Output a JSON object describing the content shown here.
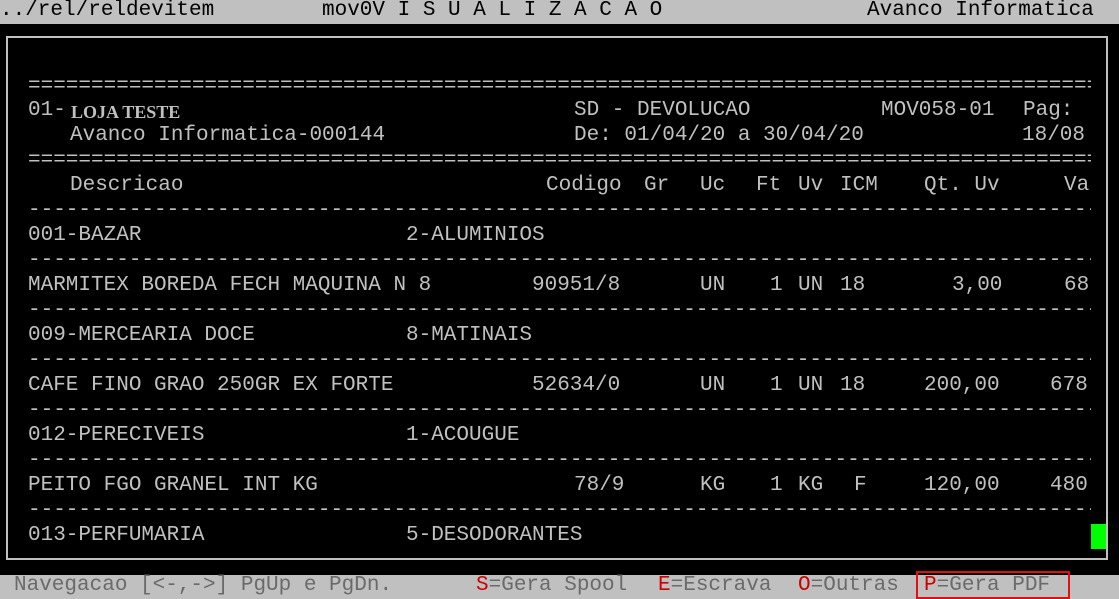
{
  "title_bar": {
    "path": "../rel/reldevitem",
    "screen_title": "mov0V I S U A L I Z A C A O",
    "company": "Avanco Informatica"
  },
  "report": {
    "separator_double": "==================================================================================================",
    "separator_single": "--------------------------------------------------------------------------------------------------",
    "header": {
      "store_code": "01-",
      "store_name": "LOJA TESTE",
      "doc_type": "SD - DEVOLUCAO",
      "report_code": "MOV058-01",
      "page_label": "Pag:",
      "company_line": "Avanco Informatica-000144",
      "period": "De: 01/04/20 a 30/04/20",
      "page_value": "18/08"
    },
    "columns": {
      "descricao": "Descricao",
      "codigo": "Codigo",
      "gr": "Gr",
      "uc": "Uc",
      "ft": "Ft",
      "uv": "Uv",
      "icm": "ICM",
      "qt_uv": "Qt. Uv",
      "va": "Va"
    },
    "groups": [
      {
        "section": "001-BAZAR",
        "subsection": "2-ALUMINIOS",
        "item": {
          "descricao": "MARMITEX BOREDA FECH MAQUINA N 8",
          "codigo": "90951/8",
          "uc": "UN",
          "ft": "1",
          "uv": "UN",
          "icm": "18",
          "qt_uv": "3,00",
          "va": "68"
        }
      },
      {
        "section": "009-MERCEARIA DOCE",
        "subsection": "8-MATINAIS",
        "item": {
          "descricao": "CAFE FINO GRAO 250GR EX FORTE",
          "codigo": "52634/0",
          "uc": "UN",
          "ft": "1",
          "uv": "UN",
          "icm": "18",
          "qt_uv": "200,00",
          "va": "678"
        }
      },
      {
        "section": "012-PERECIVEIS",
        "subsection": "1-ACOUGUE",
        "item": {
          "descricao": "PEITO FGO GRANEL INT KG",
          "codigo": "78/9",
          "uc": "KG",
          "ft": "1",
          "uv": "KG",
          "icm": "F",
          "qt_uv": "120,00",
          "va": "480"
        }
      },
      {
        "section": "013-PERFUMARIA",
        "subsection": "5-DESODORANTES"
      }
    ]
  },
  "footer": {
    "navigation": "Navegacao [<-,->] PgUp e PgDn.",
    "spool_key": "S",
    "spool_label": "=Gera Spool",
    "escrava_key": "E",
    "escrava_label": "=Escrava",
    "outras_key": "O",
    "outras_label": "=Outras",
    "pdf_key": "P",
    "pdf_label": "=Gera PDF"
  },
  "colors": {
    "background": "#000000",
    "text": "#c0c0c0",
    "bar": "#c0c0c0",
    "hotkey": "#cc0000",
    "cursor": "#00ff00",
    "highlight_box": "#e01010"
  }
}
